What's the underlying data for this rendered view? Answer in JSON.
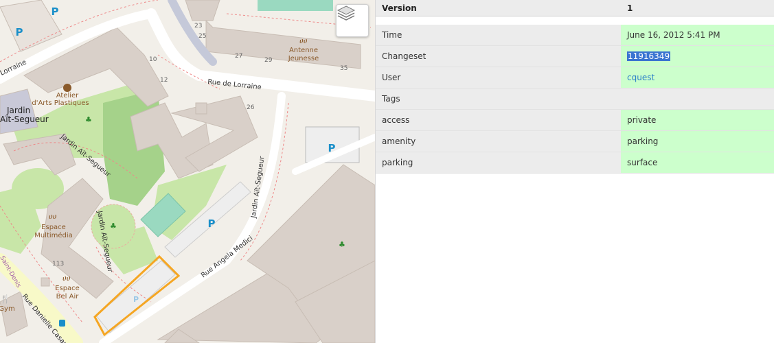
{
  "map": {
    "streets": {
      "rue_de_lorraine": "Rue de Lorraine",
      "lorraine_left": "Lorraine",
      "jardin_ait_segueur_a": "Jardin Aït-Segueur",
      "jardin_ait_segueur_b": "Jardin Aït-Segueur",
      "jardin_ait_segueur_c": "Jardin Aït-Segueur",
      "rue_angela_medici": "Rue Angela Medici",
      "rue_danielle_casanova": "Rue Danielle Casan",
      "saint_denis": "Saint-Denis"
    },
    "places": {
      "jardin_line1": "Jardin",
      "jardin_line2": "Aït-Segueur",
      "atelier_line1": "Atelier",
      "atelier_line2": "d'Arts Plastiques",
      "antenne_line1": "Antenne",
      "antenne_line2": "Jeunesse",
      "espace_mm_line1": "Espace",
      "espace_mm_line2": "Multimédia",
      "espace_ba_line1": "Espace",
      "espace_ba_line2": "Bel Air",
      "gym": "Gym"
    },
    "house_numbers": [
      "23",
      "25",
      "27",
      "29",
      "35",
      "10",
      "12",
      "26",
      "113"
    ],
    "parking_symbol": "P",
    "selected_outline_color": "#f5a623"
  },
  "panel": {
    "header": {
      "key": "Version",
      "value": "1"
    },
    "rows": [
      {
        "key": "Time",
        "value": "June 16, 2012 5:41 PM"
      },
      {
        "key": "Changeset",
        "value": "11916349"
      },
      {
        "key": "User",
        "value": "cquest"
      }
    ],
    "tags_label": "Tags",
    "tags": [
      {
        "key": "access",
        "value": "private"
      },
      {
        "key": "amenity",
        "value": "parking"
      },
      {
        "key": "parking",
        "value": "surface"
      }
    ],
    "colors": {
      "value_bg": "#ccffcc",
      "key_bg": "#ececec",
      "link": "#2b7fc9",
      "selection": "#3a74d1"
    }
  }
}
